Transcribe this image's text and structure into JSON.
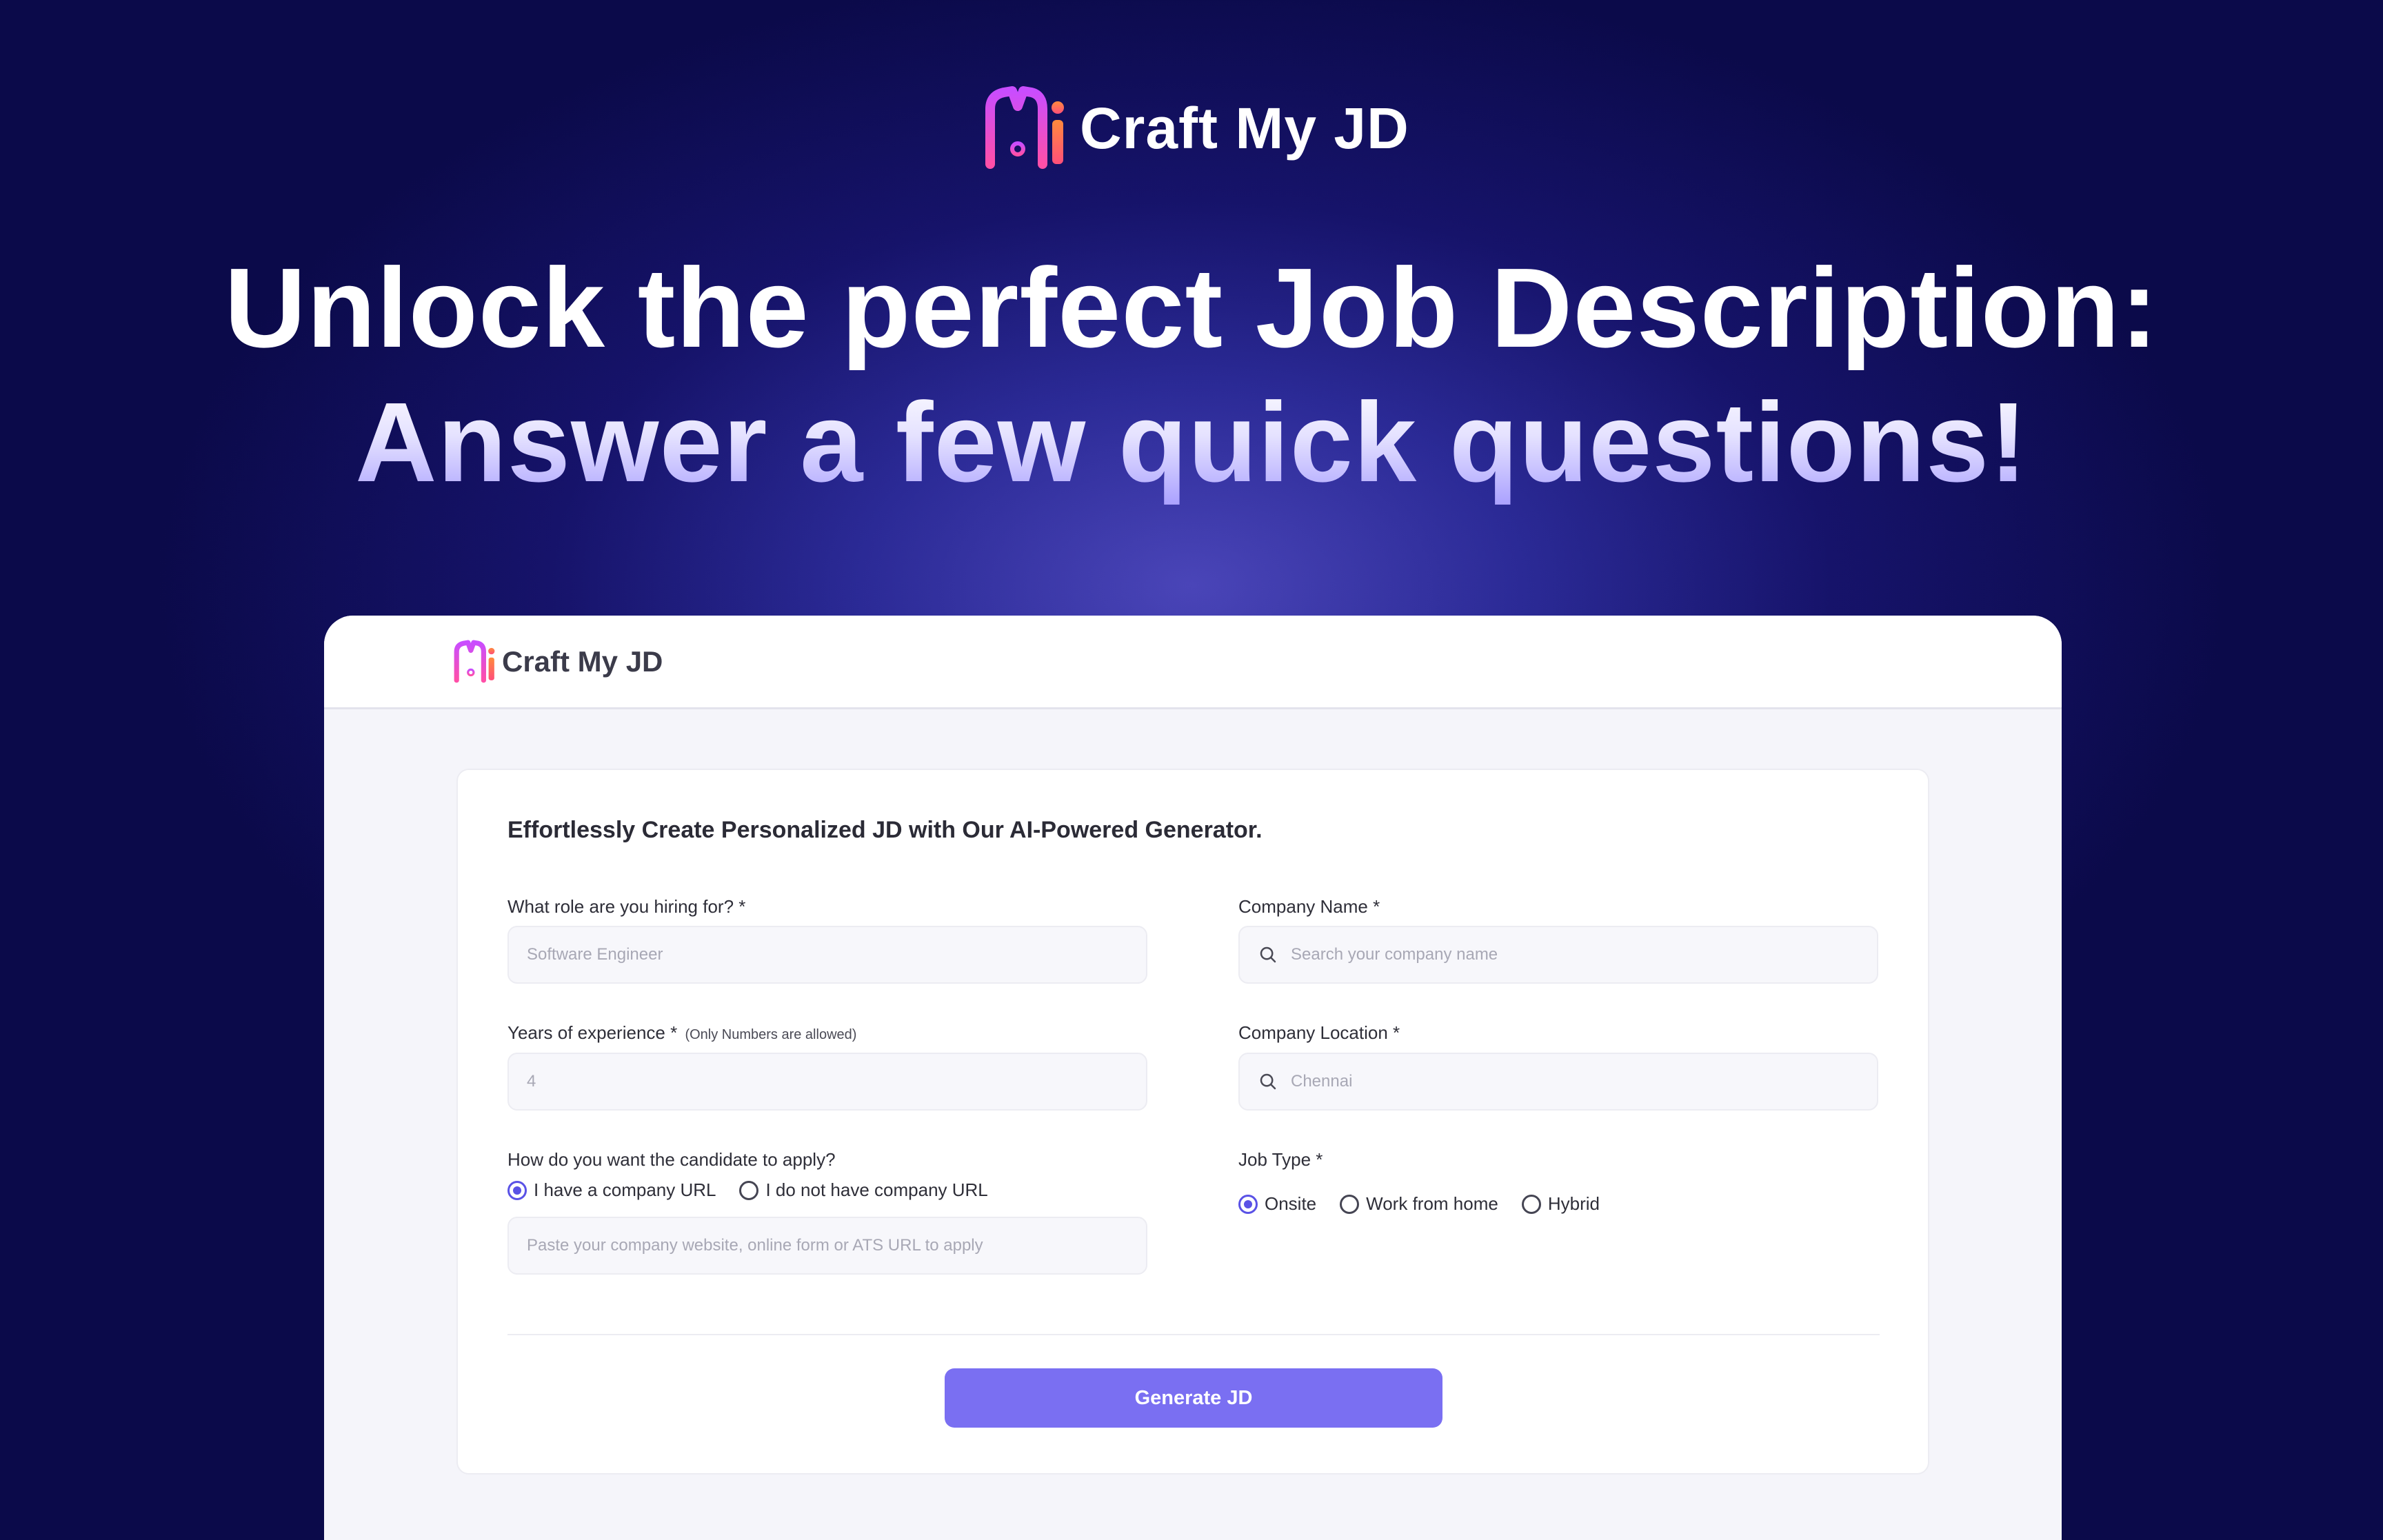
{
  "brand": {
    "name": "Craft My JD",
    "logo_icon": "mi-logo-icon"
  },
  "headline": {
    "line1": "Unlock the perfect Job Description:",
    "line2": "Answer a few quick questions!"
  },
  "app": {
    "header_brand": "Craft My JD",
    "form": {
      "title": "Effortlessly Create Personalized JD with Our AI-Powered Generator.",
      "role": {
        "label": "What role are you hiring for? *",
        "placeholder": "Software Engineer"
      },
      "company_name": {
        "label": "Company Name *",
        "placeholder": "Search your company name",
        "icon": "search-icon"
      },
      "experience": {
        "label": "Years of experience *",
        "note": "(Only Numbers are allowed)",
        "placeholder": "4"
      },
      "company_location": {
        "label": "Company Location *",
        "placeholder": "Chennai",
        "icon": "search-icon"
      },
      "apply": {
        "label": "How do you want the candidate to apply?",
        "options": [
          "I have a company URL",
          "I do not have company URL"
        ],
        "selected": "I have a company URL",
        "url_placeholder": "Paste your company website, online form or ATS URL to apply"
      },
      "job_type": {
        "label": "Job Type *",
        "options": [
          "Onsite",
          "Work from home",
          "Hybrid"
        ],
        "selected": "Onsite"
      },
      "submit_label": "Generate JD"
    }
  },
  "colors": {
    "accent": "#5a52e6",
    "button": "#7a6ff2",
    "background_dark": "#0b0a4a",
    "background_glow": "#4a45b8"
  }
}
